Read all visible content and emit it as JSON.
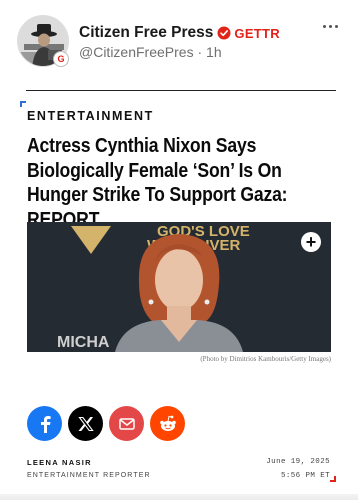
{
  "post": {
    "display_name": "Citizen Free Press",
    "platform_label": "GETTR",
    "handle": "@CitizenFreePres",
    "separator": "·",
    "age": "1h",
    "more_icon": "more-horizontal-icon",
    "verified_icon": "verified-badge-icon",
    "platform_badge_glyph": "G"
  },
  "article": {
    "category": "ENTERTAINMENT",
    "headline": "Actress Cynthia Nixon Says Biologically Female ‘Son’ Is On Hunger Strike To Support Gaza: REPORT",
    "photo_backdrop_text": "GOD'S LOVE WE DELIVER",
    "photo_backdrop_text_2": "MICHA",
    "photo_caption": "(Photo by Dimitrios Kambouris/Getty Images)",
    "photo_action_icon": "plus-icon"
  },
  "share": {
    "buttons": [
      {
        "name": "facebook",
        "icon": "facebook-icon",
        "color": "#1877f2"
      },
      {
        "name": "x",
        "icon": "x-icon",
        "color": "#000000"
      },
      {
        "name": "email",
        "icon": "mail-icon",
        "color": "#e44747"
      },
      {
        "name": "reddit",
        "icon": "reddit-icon",
        "color": "#ff4500"
      }
    ]
  },
  "byline": {
    "author": "LEENA NASIR",
    "role": "ENTERTAINMENT REPORTER",
    "date": "June 19, 2025",
    "time": "5:56 PM ET"
  },
  "colors": {
    "accent_blue": "#2f6fd6",
    "accent_red": "#e2231a"
  }
}
